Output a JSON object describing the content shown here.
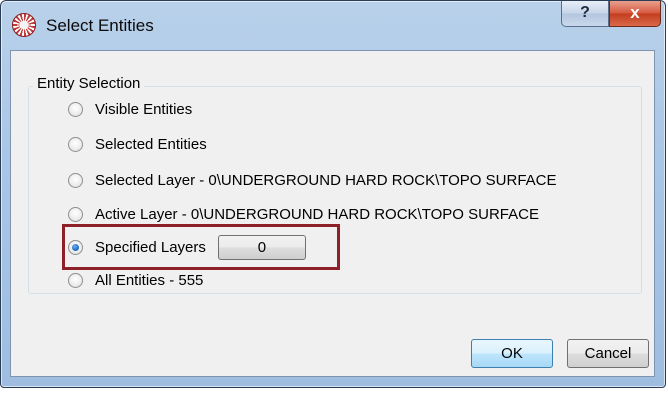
{
  "window": {
    "title": "Select Entities",
    "help_label": "?",
    "close_label": "x"
  },
  "group": {
    "label": "Entity Selection"
  },
  "options": [
    {
      "label": "Visible Entities",
      "checked": false
    },
    {
      "label": "Selected Entities",
      "checked": false
    },
    {
      "label": "Selected Layer - 0\\UNDERGROUND HARD ROCK\\TOPO SURFACE",
      "checked": false
    },
    {
      "label": "Active Layer - 0\\UNDERGROUND HARD ROCK\\TOPO SURFACE",
      "checked": false
    },
    {
      "label": "Specified Layers",
      "checked": true
    },
    {
      "label": "All Entities - 555",
      "checked": false
    }
  ],
  "specified_layers_value": "0",
  "buttons": {
    "ok": "OK",
    "cancel": "Cancel"
  },
  "colors": {
    "highlight_border": "#8e2028",
    "title_bar": "#aac6e6",
    "close_button": "#c23d1e"
  }
}
